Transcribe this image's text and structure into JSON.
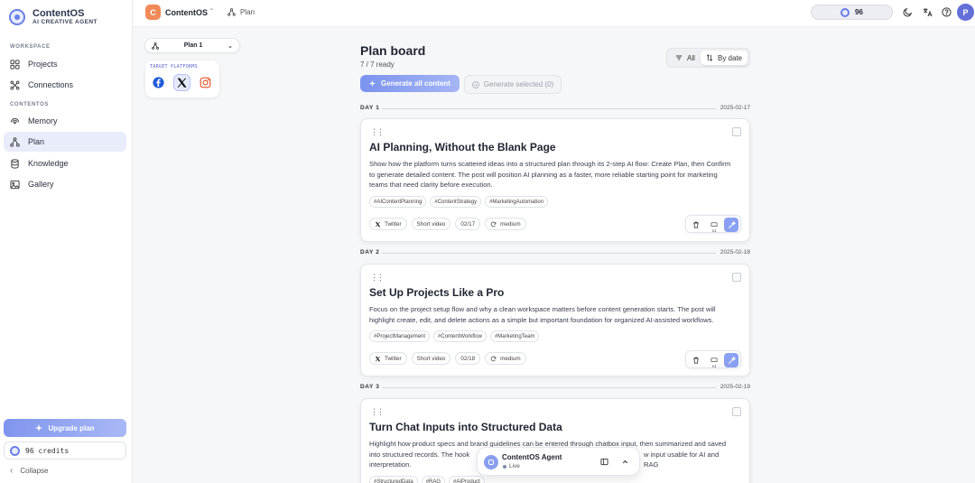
{
  "brand": {
    "name": "ContentOS",
    "tagline": "AI CREATIVE AGENT"
  },
  "sidebar": {
    "sections": {
      "workspace": "WORKSPACE",
      "contentos": "CONTENTOS"
    },
    "items": [
      {
        "label": "Projects",
        "icon": "grid-icon"
      },
      {
        "label": "Connections",
        "icon": "connections-icon"
      },
      {
        "label": "Memory",
        "icon": "memory-icon"
      },
      {
        "label": "Plan",
        "icon": "plan-icon",
        "active": true
      },
      {
        "label": "Knowledge",
        "icon": "database-icon"
      },
      {
        "label": "Gallery",
        "icon": "image-icon"
      }
    ],
    "upgrade_label": "Upgrade plan",
    "credits_label": "96 credits",
    "collapse_label": "Collapse"
  },
  "topbar": {
    "project_initial": "C",
    "project_name": "ContentOS",
    "breadcrumb": "Plan",
    "credits": "96",
    "avatar_initial": "P"
  },
  "plan_selector": {
    "label": "Plan 1"
  },
  "target_platforms": {
    "title": "TARGET PLATFORMS",
    "platforms": [
      {
        "name": "Facebook",
        "selected": false
      },
      {
        "name": "X",
        "selected": true
      },
      {
        "name": "Instagram",
        "selected": false
      }
    ]
  },
  "board": {
    "title": "Plan board",
    "subtitle": "7 / 7 ready",
    "generate_all": "Generate all content",
    "generate_selected": "Generate selected (0)",
    "filter_all": "All",
    "filter_by_date": "By date"
  },
  "days": [
    {
      "label": "DAY 1",
      "date": "2025-02-17",
      "card": {
        "title": "AI Planning, Without the Blank Page",
        "description": "Show how the platform turns scattered ideas into a structured plan through its 2-step AI flow: Create Plan, then Confirm to generate detailed content. The post will position AI planning as a faster, more reliable starting point for marketing teams that need clarity before execution.",
        "tags": [
          "#AIContentPlanning",
          "#ContentStrategy",
          "#MarketingAutomation"
        ],
        "platform": "Twitter",
        "format": "Short video",
        "date": "02/17",
        "length": "medium",
        "count": "x1"
      }
    },
    {
      "label": "DAY 2",
      "date": "2025-02-18",
      "card": {
        "title": "Set Up Projects Like a Pro",
        "description": "Focus on the project setup flow and why a clean workspace matters before content generation starts. The post will highlight create, edit, and delete actions as a simple but important foundation for organized AI-assisted workflows.",
        "tags": [
          "#ProjectManagement",
          "#ContentWorkflow",
          "#MarketingTeam"
        ],
        "platform": "Twitter",
        "format": "Short video",
        "date": "02/18",
        "length": "medium",
        "count": "x1"
      }
    },
    {
      "label": "DAY 3",
      "date": "2025-02-19",
      "card": {
        "title": "Turn Chat Inputs into Structured Data",
        "description_lines": [
          "Highlight how product specs and brand guidelines can be entered through chatbox input, then summarized and saved",
          "into structured records. The hook",
          "w input usable for AI and RAG",
          "interpretation."
        ],
        "tags": [
          "#StructuredData",
          "#RAG",
          "#AIProduct"
        ]
      }
    }
  ],
  "agent": {
    "name": "ContentOS Agent",
    "status": "Live"
  }
}
